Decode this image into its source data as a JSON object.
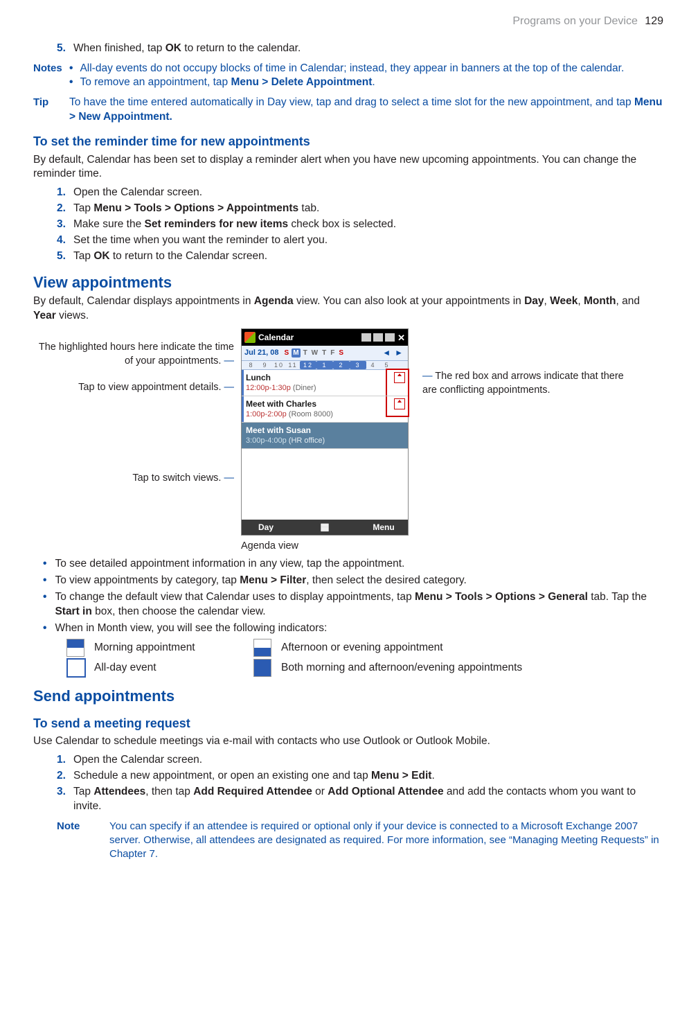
{
  "header": {
    "section": "Programs on your Device",
    "page": "129"
  },
  "top": {
    "step5_num": "5.",
    "step5_a": "When finished, tap ",
    "step5_b": "OK",
    "step5_c": " to return to the calendar.",
    "notes_label": "Notes",
    "note1": "All-day events do not occupy blocks of time in Calendar; instead, they appear in banners at the top of the calendar.",
    "note2_a": "To remove an appointment, tap ",
    "note2_b": "Menu > Delete Appointment",
    "note2_c": ".",
    "tip_label": "Tip",
    "tip_a": "To have the time entered automatically in Day view, tap and drag to select a time slot for the new appointment, and tap ",
    "tip_b": "Menu > New Appointment.",
    "h_reminder": "To set the reminder time for new appointments",
    "rem_para": "By default, Calendar has been set to display a reminder alert when you have new upcoming appointments. You can change the reminder time.",
    "r1n": "1.",
    "r1": "Open the Calendar screen.",
    "r2n": "2.",
    "r2a": "Tap ",
    "r2b": "Menu > Tools > Options > Appointments",
    "r2c": " tab.",
    "r3n": "3.",
    "r3a": "Make sure the ",
    "r3b": "Set reminders for new items",
    "r3c": " check box is selected.",
    "r4n": "4.",
    "r4": "Set the time when you want the reminder to alert you.",
    "r5n": "5.",
    "r5a": "Tap ",
    "r5b": "OK",
    "r5c": " to return to the Calendar screen."
  },
  "view": {
    "h2": "View appointments",
    "para_a": "By default, Calendar displays appointments in ",
    "para_b": "Agenda",
    "para_c": " view. You can also look at your appointments in ",
    "para_d": "Day",
    "para_e": ", ",
    "para_f": "Week",
    "para_g": ", ",
    "para_h": "Month",
    "para_i": ", and ",
    "para_j": "Year",
    "para_k": " views.",
    "callouts": {
      "left1": "The highlighted hours here indicate the time of your appointments.",
      "left2": "Tap to view appointment details.",
      "left3": "Tap to switch views.",
      "right1": "The red box and arrows indicate that there are conflicting appointments."
    },
    "phone": {
      "title": "Calendar",
      "date": "Jul  21, 08",
      "dow": {
        "S1": "S",
        "M": "M",
        "T1": "T",
        "W": "W",
        "T2": "T",
        "F": "F",
        "S2": "S"
      },
      "hours": [
        "8",
        "9",
        "10",
        "11",
        "12",
        "1",
        "2",
        "3",
        "4",
        "5"
      ],
      "appts": [
        {
          "name": "Lunch",
          "time": "12:00p-1:30p",
          "loc": " (Diner)"
        },
        {
          "name": "Meet with Charles",
          "time": "1:00p-2:00p",
          "loc": " (Room 8000)"
        },
        {
          "name": "Meet with Susan",
          "time": "3:00p-4:00p",
          "loc": " (HR office)"
        }
      ],
      "soft_left": "Day",
      "soft_right": "Menu"
    },
    "figcaption": "Agenda view",
    "b1": "To see detailed appointment information in any view, tap the appointment.",
    "b2a": "To view appointments by category, tap ",
    "b2b": "Menu > Filter",
    "b2c": ", then select the desired category.",
    "b3a": "To change the default view that Calendar uses to display appointments, tap ",
    "b3b": "Menu > Tools > Options > General",
    "b3c": " tab. Tap the ",
    "b3d": "Start in",
    "b3e": " box, then choose the calendar view.",
    "b4": "When in Month view, you will see the following indicators:",
    "ind": {
      "morning": "Morning appointment",
      "afternoon": "Afternoon or evening appointment",
      "allday": "All-day event",
      "both": "Both morning and afternoon/evening appointments"
    }
  },
  "send": {
    "h2": "Send appointments",
    "h3": "To send a meeting request",
    "para": "Use Calendar to schedule meetings via e-mail with contacts who use Outlook or Outlook Mobile.",
    "s1n": "1.",
    "s1": "Open the Calendar screen.",
    "s2n": "2.",
    "s2a": "Schedule a new appointment, or open an existing one and tap ",
    "s2b": "Menu > Edit",
    "s2c": ".",
    "s3n": "3.",
    "s3a": "Tap ",
    "s3b": "Attendees",
    "s3c": ", then tap ",
    "s3d": "Add Required Attendee",
    "s3e": " or ",
    "s3f": "Add Optional Attendee",
    "s3g": " and add the contacts whom you want to invite.",
    "note_label": "Note",
    "note": "You can specify if an attendee is required or optional only if your device is connected to a Microsoft Exchange 2007 server. Otherwise, all attendees are designated as required. For more information, see “Managing Meeting Requests” in Chapter 7."
  }
}
